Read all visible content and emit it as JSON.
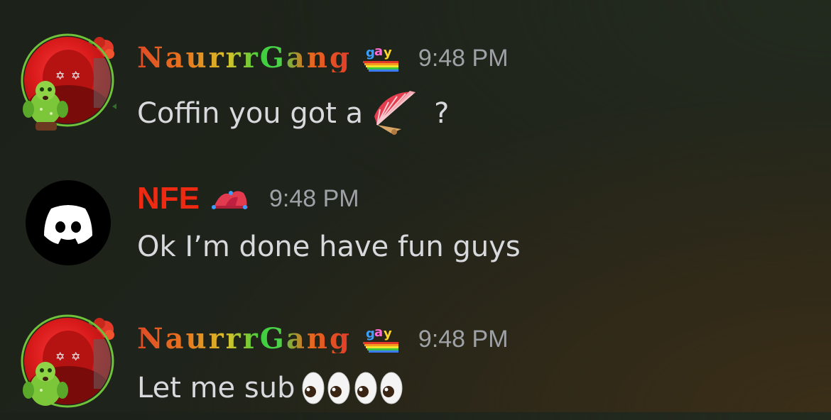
{
  "messages": [
    {
      "username": "NaurrrGang",
      "badge_text": "gay",
      "timestamp": "9:48 PM",
      "content_before": "Coffin you got a",
      "content_emoji": "folding-fan-emoji",
      "content_after": "?"
    },
    {
      "username": "NFE",
      "badge_text": "",
      "timestamp": "9:48 PM",
      "content_before": "Ok I’m done have fun guys",
      "content_emoji": "",
      "content_after": ""
    },
    {
      "username": "NaurrrGang",
      "badge_text": "gay",
      "timestamp": "9:48 PM",
      "content_before": "Let me sub",
      "content_emoji": "eyes-emoji",
      "content_after": ""
    }
  ],
  "colors": {
    "username_nfe": "#ee2a12",
    "timestamp": "#9ea1a5",
    "message_text": "#d7d9dc",
    "discord_avatar_bg": "#000000"
  }
}
